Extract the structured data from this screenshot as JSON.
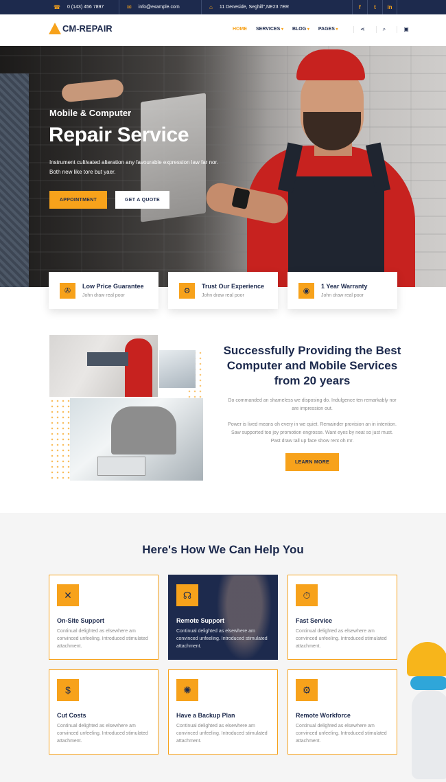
{
  "topbar": {
    "phone": "0 (143) 456 7897",
    "email": "info@example.com",
    "address": "11 Deneside, Seghill\",NE23 7ER",
    "social": [
      {
        "icon": "facebook-icon",
        "glyph": "f"
      },
      {
        "icon": "twitter-icon",
        "glyph": "t"
      },
      {
        "icon": "linkedin-icon",
        "glyph": "in"
      }
    ]
  },
  "header": {
    "logo": "CM-REPAIR",
    "nav": [
      {
        "label": "HOME",
        "active": true,
        "dropdown": false
      },
      {
        "label": "SERVICES",
        "active": false,
        "dropdown": true
      },
      {
        "label": "BLOG",
        "active": false,
        "dropdown": true
      },
      {
        "label": "PAGES",
        "active": false,
        "dropdown": true
      }
    ],
    "icons": [
      "share-icon",
      "search-icon",
      "cart-icon"
    ]
  },
  "hero": {
    "subtitle": "Mobile & Computer",
    "title": "Repair Service",
    "text": "Instrument cultivated alteration any favourable expression law far nor. Both new like tore but yaer.",
    "btn_primary": "APPOINTMENT",
    "btn_secondary": "GET A QUOTE"
  },
  "features": [
    {
      "title": "Low Price Guarantee",
      "sub": "John draw real poor",
      "icon": "price-tag-icon",
      "glyph": "✇"
    },
    {
      "title": "Trust Our Experience",
      "sub": "John draw real poor",
      "icon": "gears-icon",
      "glyph": "⚙"
    },
    {
      "title": "1 Year Warranty",
      "sub": "John draw real poor",
      "icon": "warranty-badge-icon",
      "glyph": "◉"
    }
  ],
  "about": {
    "title": "Successfully Providing the Best Computer and Mobile Services from 20 years",
    "p1": "Do commanded an shameless we disposing do. Indulgence ten remarkably nor are impression out.",
    "p2": "Power is lived means oh every in we quiet. Remainder provision an in intention. Saw supported too joy promotion engrosse. Want eyes by neat so just must. Past draw tall up face show rent oh mr.",
    "button": "LEARN MORE"
  },
  "services": {
    "title": "Here's How We Can Help You",
    "cards": [
      {
        "title": "On-Site Support",
        "text": "Continual delighted as elsewhere am convinced unfeeling. Introduced stimulated attachment.",
        "icon": "tools-icon",
        "glyph": "✕",
        "dark": false
      },
      {
        "title": "Remote Support",
        "text": "Continual delighted as elsewhere am convinced unfeeling. Introduced stimulated attachment.",
        "icon": "headset-icon",
        "glyph": "☊",
        "dark": true
      },
      {
        "title": "Fast Service",
        "text": "Continual delighted as elsewhere am convinced unfeeling. Introduced stimulated attachment.",
        "icon": "stopwatch-icon",
        "glyph": "⏱",
        "dark": false
      },
      {
        "title": "Cut Costs",
        "text": "Continual delighted as elsewhere am convinced unfeeling. Introduced stimulated attachment.",
        "icon": "money-icon",
        "glyph": "$",
        "dark": false
      },
      {
        "title": "Have a Backup Plan",
        "text": "Continual delighted as elsewhere am convinced unfeeling. Introduced stimulated attachment.",
        "icon": "brain-icon",
        "glyph": "✺",
        "dark": false
      },
      {
        "title": "Remote Workforce",
        "text": "Continual delighted as elsewhere am convinced unfeeling. Introduced stimulated attachment.",
        "icon": "cogs-icon",
        "glyph": "⚙",
        "dark": false
      }
    ]
  },
  "colors": {
    "accent": "#f7a21b",
    "navy": "#1d2a4d"
  }
}
